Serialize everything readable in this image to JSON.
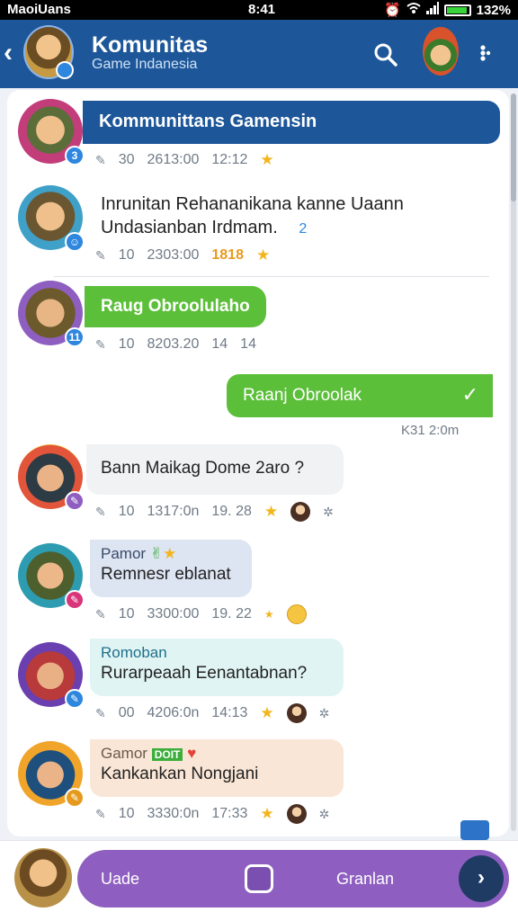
{
  "status_bar": {
    "carrier": "MaoiUans",
    "time": "8:41",
    "battery": "132%",
    "battery_level": 0.95
  },
  "header": {
    "title": "Komunitas",
    "subtitle": "Game Indanesia"
  },
  "messages": [
    {
      "text": "Kommunittans Gamensin",
      "meta": [
        "30",
        "2613:00",
        "12:12"
      ],
      "badge": "3"
    },
    {
      "text_line1": "Inrunitan Rehananikana kanne Uaann",
      "text_line2": "Undasianban Irdmam.",
      "trail": "2",
      "meta": [
        "10",
        "2303:00",
        "1818"
      ],
      "badge": ""
    },
    {
      "text": "Raug Obroolulaho",
      "meta": [
        "10",
        "8203.20",
        "14",
        "14"
      ],
      "badge": "11"
    },
    {
      "text": "Raanj Obroolak",
      "time": "K31 2:0m",
      "check": "✓"
    },
    {
      "text": "Bann Maikag Dome 2aro ?",
      "meta": [
        "10",
        "1317:0n",
        "19. 28"
      ],
      "badge": ""
    },
    {
      "title": "Pamor",
      "text": "Remnesr eblanat",
      "meta": [
        "10",
        "3300:00",
        "19. 22"
      ],
      "badge": ""
    },
    {
      "title": "Romoban",
      "text": "Rurarpeaah Eenantabnan?",
      "meta": [
        "00",
        "4206:0n",
        "14:13"
      ],
      "badge": ""
    },
    {
      "title": "Gamor",
      "title_tag": "DOIT",
      "text": "Kankankan Nongjani",
      "meta": [
        "10",
        "3330:0n",
        "17:33"
      ],
      "badge": ""
    }
  ],
  "composer": {
    "left_label": "Uade",
    "right_label": "Granlan",
    "send_icon": "chevron-right-icon"
  },
  "colors": {
    "header": "#1e5799",
    "green": "#5cbf3a",
    "purple": "#8e5fc0",
    "gray_bubble": "#f1f2f4",
    "lavender_bubble": "#dde4f2",
    "mint_bubble": "#e0f4f4",
    "peach_bubble": "#fae6d6"
  }
}
